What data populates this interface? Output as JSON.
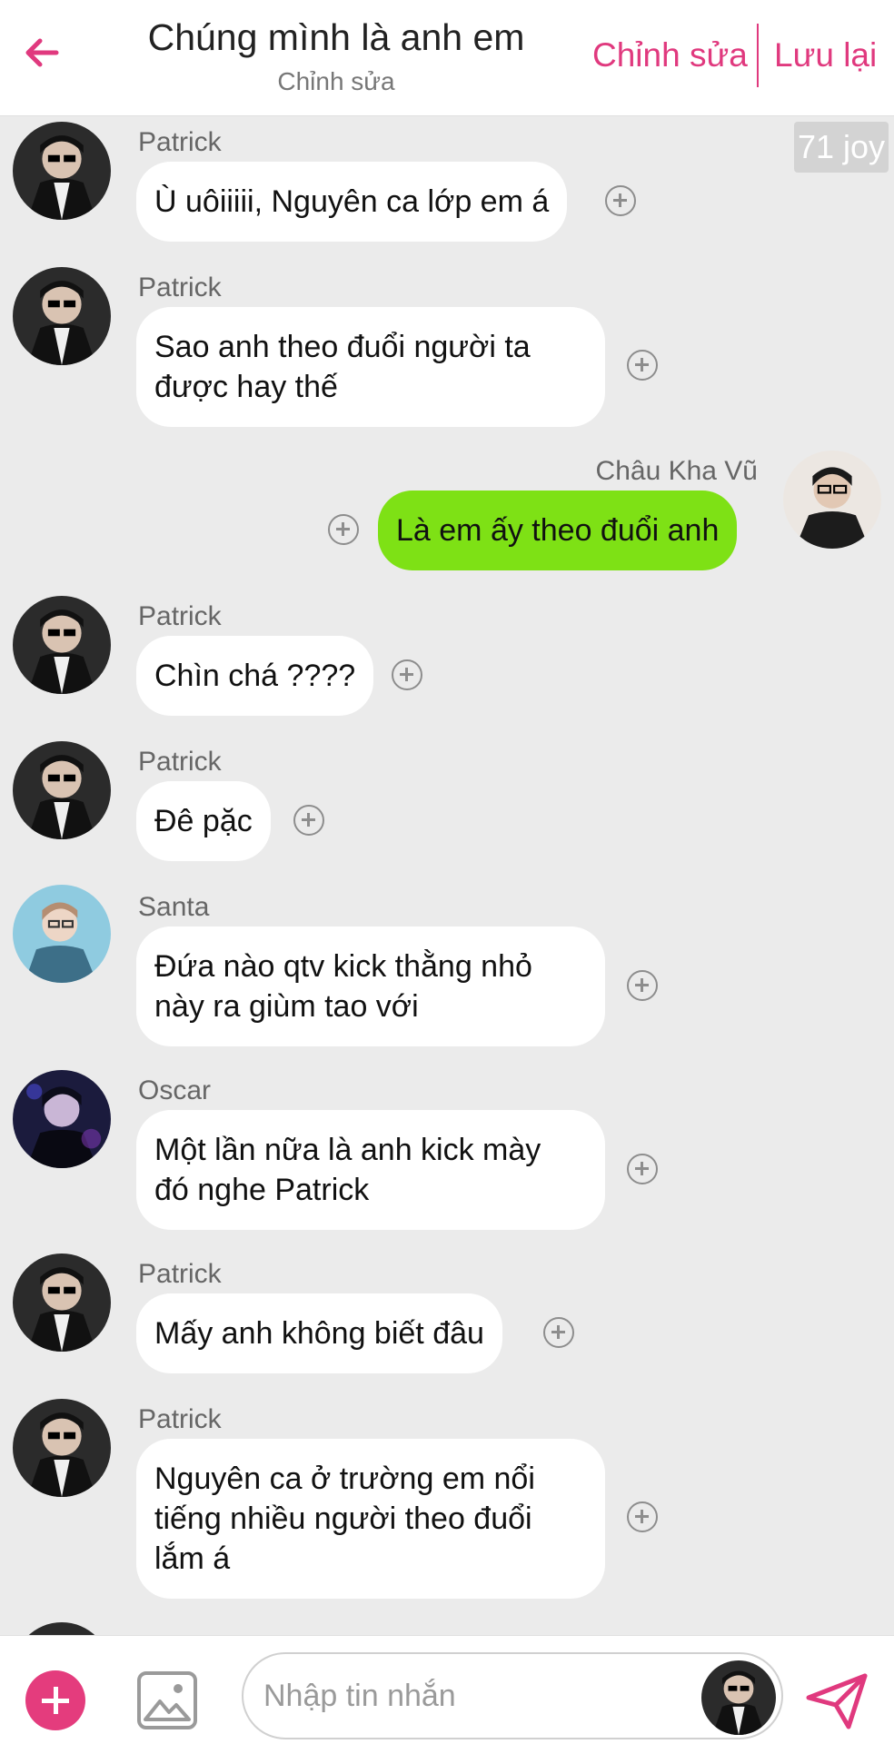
{
  "header": {
    "title": "Chúng mình là anh em",
    "subtitle": "Chỉnh sửa",
    "edit_label": "Chỉnh sửa",
    "save_label": "Lưu lại"
  },
  "joy_badge": "71 joy",
  "messages": [
    {
      "sender": "Patrick",
      "text": "Ù uôiiiii, Nguyên ca lớp em á",
      "self": false,
      "avatar": "patrick"
    },
    {
      "sender": "Patrick",
      "text": "Sao anh theo đuổi người ta\nđược hay thế",
      "self": false,
      "avatar": "patrick"
    },
    {
      "sender": "Châu Kha Vũ",
      "text": "Là em ấy theo đuổi anh",
      "self": true,
      "avatar": "chau-kha-vu"
    },
    {
      "sender": "Patrick",
      "text": "Chìn chá ????",
      "self": false,
      "avatar": "patrick"
    },
    {
      "sender": "Patrick",
      "text": "Đê pặc",
      "self": false,
      "avatar": "patrick"
    },
    {
      "sender": "Santa",
      "text": "Đứa nào qtv kick thằng nhỏ\nnày ra giùm tao với",
      "self": false,
      "avatar": "santa"
    },
    {
      "sender": "Oscar",
      "text": "Một lần nữa là anh kick mày\nđó nghe Patrick",
      "self": false,
      "avatar": "oscar"
    },
    {
      "sender": "Patrick",
      "text": "Mấy anh không biết đâu",
      "self": false,
      "avatar": "patrick"
    },
    {
      "sender": "Patrick",
      "text": "Nguyên ca ở trường em nổi\ntiếng nhiều người theo đuổi\nlắm á",
      "self": false,
      "avatar": "patrick"
    }
  ],
  "composer": {
    "placeholder": "Nhập tin nhắn"
  },
  "icons": {
    "back": "arrow-left-icon",
    "react": "add-reaction-icon",
    "plus": "plus-icon",
    "image": "image-icon",
    "send": "send-icon"
  },
  "colors": {
    "accent": "#e0397e",
    "self_bubble": "#7ee115",
    "other_bubble": "#ffffff",
    "background": "#ebebeb"
  }
}
